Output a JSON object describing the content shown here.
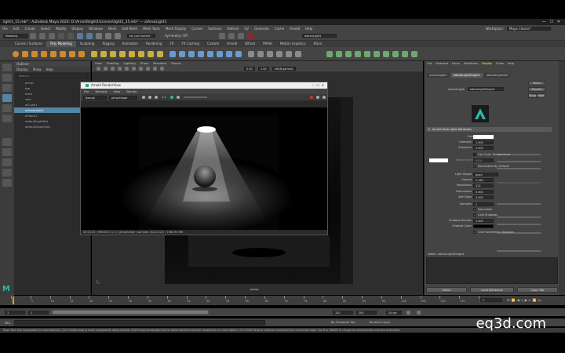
{
  "window": {
    "title": "light1_15.mb* - Autodesk Maya 2020: D:\\Arnold\\light1\\scenes\\light1_15.mb* --- aiAreaLight1"
  },
  "menubar": [
    "File",
    "Edit",
    "Create",
    "Select",
    "Modify",
    "Display",
    "Windows",
    "Mesh",
    "Edit Mesh",
    "Mesh Tools",
    "Mesh Display",
    "Curves",
    "Surfaces",
    "Deform",
    "UV",
    "Generate",
    "Cache",
    "Arnold",
    "Help"
  ],
  "workspace": {
    "label": "Workspace:",
    "value": "Maya Classic*"
  },
  "statusline": {
    "mode": "Modeling",
    "live_surface": "No Live Surface",
    "symmetry": "Symmetry: Off",
    "field1": "0.00",
    "field2": "1.00",
    "colorspace": "sRGB gamma",
    "search_value": "aiAreaLight1"
  },
  "shelf_tabs": [
    "Curves / Surfaces",
    "Poly Modeling",
    "Sculpting",
    "Rigging",
    "Animation",
    "Rendering",
    "FX",
    "FX Caching",
    "Custom",
    "Arnold",
    "Bifrost",
    "MASH",
    "Motion Graphics",
    "XGen"
  ],
  "shelf_active": "Poly Modeling",
  "outliner": {
    "title": "Outliner",
    "menu": [
      "Display",
      "Show",
      "Help"
    ],
    "search_placeholder": "Search...",
    "items": [
      "persp",
      "top",
      "front",
      "side",
      "aiCube1",
      "aiAreaLight1",
      "pPlane1",
      "defaultLightSet",
      "defaultObjectSet"
    ],
    "selected_index": 5
  },
  "viewport": {
    "menu": [
      "View",
      "Shading",
      "Lighting",
      "Show",
      "Renderer",
      "Panels"
    ],
    "field1": "0.00",
    "field2": "1.00",
    "colorspace": "sRGB gamma",
    "camera_label": "persp"
  },
  "render_view": {
    "title": "Arnold RenderView",
    "menu": [
      "File",
      "Window",
      "View",
      "Render"
    ],
    "aov": "Beauty",
    "camera": "perspShape",
    "exposure": "1:1",
    "status": "00:00:04 | 960x540 (1:1) | perspShape | samples 3/2/2/2/2/2 | 1083.93 MB"
  },
  "attribute_editor": {
    "menu": [
      "List",
      "Selected",
      "Focus",
      "Attributes",
      "Display",
      "Show",
      "Help"
    ],
    "tabs": [
      "aiAreaLight1",
      "aiAreaLightShape1",
      "defaultLightSet"
    ],
    "node_label": "aiAreaLight:",
    "node_value": "aiAreaLightShape1",
    "focus_btn": "Focus",
    "presets_btn": "Presets",
    "show_btn": "Show",
    "hide_btn": "Hide",
    "section": "Arnold Area Light Attributes",
    "attrs": {
      "color": "Color",
      "intensity": {
        "label": "Intensity",
        "value": "1.000"
      },
      "exposure": {
        "label": "Exposure",
        "value": "5.000"
      },
      "use_color_temperature": "Use Color Temperature",
      "temperature": {
        "label": "Temperature",
        "value": "6500"
      },
      "illuminates": "Illuminates By Default",
      "light_shape": {
        "label": "Light Shape",
        "value": "quad"
      },
      "spread": {
        "label": "Spread",
        "value": "0.169"
      },
      "resolution": {
        "label": "Resolution",
        "value": "512"
      },
      "roundness": {
        "label": "Roundness",
        "value": "0.000"
      },
      "soft_edge": {
        "label": "Soft Edge",
        "value": "0.000"
      },
      "samples": {
        "label": "Samples",
        "value": "1"
      },
      "normalize": "Normalize",
      "cast_shadows": "Cast Shadows",
      "shadow_density": {
        "label": "Shadow Density",
        "value": "1.000"
      },
      "shadow_color": "Shadow Color",
      "cast_volumetric": "Cast Volumetric Shadows"
    },
    "notes_label": "Notes: aiAreaLightShape1",
    "select_btn": "Select",
    "load_btn": "Load Attributes",
    "copy_btn": "Copy Tab"
  },
  "time": {
    "ticks": [
      "1",
      "5",
      "10",
      "15",
      "20",
      "25",
      "30",
      "35",
      "40",
      "45",
      "50",
      "55",
      "60",
      "65",
      "70",
      "75",
      "80",
      "85",
      "90",
      "95",
      "100",
      "105",
      "110",
      "115",
      "120"
    ],
    "current_frame": "1",
    "start": "1",
    "range_start": "1",
    "range_end": "120",
    "end": "120",
    "anim_end": "200",
    "fps": "24 fps",
    "character": "No Character Set",
    "anim_layer": "No Anim Layer"
  },
  "cmdline": {
    "label": "MEL"
  },
  "helpline": "Move Tool: Use manipulator to move object(s). Ctrl+middle-drag to move components along normals. Shift+drag manipulator axis or plane handle to extrude components or clone objects. Ctrl+Shift+drag to constrain movement to a connected edge. Use D or INSERT to change the pivot position and axis orientation.",
  "watermark": "eq3d.com",
  "colors": {
    "selection": "#5285a6",
    "panel": "#444444",
    "dark": "#2b2b2b",
    "logo": "#2fb8a6"
  }
}
